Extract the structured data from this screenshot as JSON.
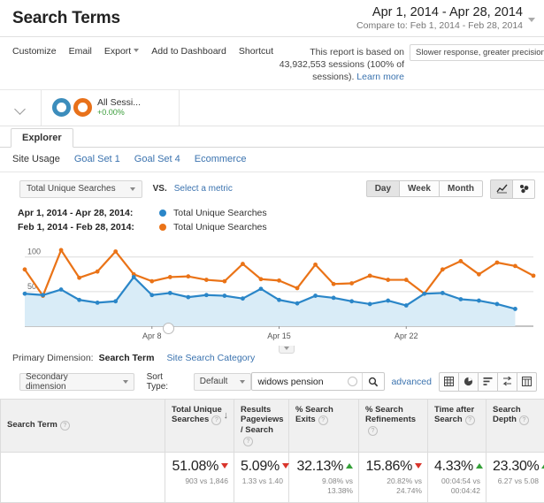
{
  "header": {
    "title": "Search Terms",
    "date_range": "Apr 1, 2014 - Apr 28, 2014",
    "compare_to": "Compare to: Feb 1, 2014 - Feb 28, 2014"
  },
  "actionbar": {
    "actions": [
      {
        "label": "Customize",
        "caret": false
      },
      {
        "label": "Email",
        "caret": false
      },
      {
        "label": "Export",
        "caret": true
      },
      {
        "label": "Add to Dashboard",
        "caret": false
      },
      {
        "label": "Shortcut",
        "caret": false
      }
    ],
    "sampling_line1": "This report is based on",
    "sampling_line2": "43,932,553 sessions (100% of",
    "sampling_line3": "sessions).",
    "sampling_link": "Learn more",
    "precision_option": "Slower response, greater precision"
  },
  "segment": {
    "name": "All Sessi...",
    "change": "+0.00%",
    "color_blue": "#3c8dbc",
    "color_orange": "#e8711a"
  },
  "explorer": {
    "tab": "Explorer",
    "subtabs": [
      {
        "label": "Site Usage",
        "active": true
      },
      {
        "label": "Goal Set 1",
        "active": false
      },
      {
        "label": "Goal Set 4",
        "active": false
      },
      {
        "label": "Ecommerce",
        "active": false
      }
    ]
  },
  "metricrow": {
    "metric": "Total Unique Searches",
    "vs": "VS.",
    "select_metric": "Select a metric",
    "granularity": [
      {
        "label": "Day",
        "active": true
      },
      {
        "label": "Week",
        "active": false
      },
      {
        "label": "Month",
        "active": false
      }
    ]
  },
  "legend": [
    {
      "date": "Apr 1, 2014 - Apr 28, 2014:",
      "color": "#2a86c8",
      "metric": "Total Unique Searches"
    },
    {
      "date": "Feb 1, 2014 - Feb 28, 2014:",
      "color": "#ea7317",
      "metric": "Total Unique Searches"
    }
  ],
  "primary_dimension": {
    "label": "Primary Dimension:",
    "active": "Search Term",
    "link": "Site Search Category"
  },
  "controls": {
    "secondary_dimension": "Secondary dimension",
    "sort_type_label": "Sort Type:",
    "sort_type_value": "Default",
    "search_value": "widows pension",
    "search_placeholder": "",
    "advanced": "advanced"
  },
  "table": {
    "columns": [
      {
        "label": "Search Term",
        "sorted": false
      },
      {
        "label": "Total Unique Searches",
        "sorted": true
      },
      {
        "label": "Results Pageviews / Search",
        "sorted": false
      },
      {
        "label": "% Search Exits",
        "sorted": false
      },
      {
        "label": "% Search Refinements",
        "sorted": false
      },
      {
        "label": "Time after Search",
        "sorted": false
      },
      {
        "label": "Search Depth",
        "sorted": false
      }
    ],
    "summary_row": [
      {
        "value": "51.08%",
        "direction": "down",
        "sub": "903 vs 1,846"
      },
      {
        "value": "5.09%",
        "direction": "down",
        "sub": "1.33 vs 1.40"
      },
      {
        "value": "32.13%",
        "direction": "up",
        "sub": "9.08% vs 13.38%"
      },
      {
        "value": "15.86%",
        "direction": "down",
        "sub": "20.82% vs 24.74%"
      },
      {
        "value": "4.33%",
        "direction": "up",
        "sub": "00:04:54 vs 00:04:42"
      },
      {
        "value": "23.30%",
        "direction": "up",
        "sub": "6.27 vs 5.08"
      }
    ]
  },
  "chart_data": {
    "type": "line",
    "title": "Total Unique Searches",
    "xlabel": "",
    "ylabel": "",
    "ylim": [
      0,
      115
    ],
    "yticks": [
      50,
      100
    ],
    "xticks": [
      "Apr 8",
      "Apr 15",
      "Apr 22"
    ],
    "xtick_indices": [
      7,
      14,
      21
    ],
    "grid": true,
    "legend_position": "above-chart",
    "area_fill": true,
    "x": [
      "Apr 1",
      "Apr 2",
      "Apr 3",
      "Apr 4",
      "Apr 5",
      "Apr 6",
      "Apr 7",
      "Apr 8",
      "Apr 9",
      "Apr 10",
      "Apr 11",
      "Apr 12",
      "Apr 13",
      "Apr 14",
      "Apr 15",
      "Apr 16",
      "Apr 17",
      "Apr 18",
      "Apr 19",
      "Apr 20",
      "Apr 21",
      "Apr 22",
      "Apr 23",
      "Apr 24",
      "Apr 25",
      "Apr 26",
      "Apr 27",
      "Apr 28"
    ],
    "series": [
      {
        "name": "Total Unique Searches",
        "period": "Apr 1, 2014 - Apr 28, 2014",
        "color": "#2a86c8",
        "values": [
          47,
          45,
          53,
          38,
          34,
          36,
          71,
          45,
          48,
          42,
          45,
          44,
          40,
          54,
          38,
          33,
          44,
          41,
          36,
          32,
          37,
          30,
          47,
          48,
          39,
          37,
          32,
          25
        ]
      },
      {
        "name": "Total Unique Searches",
        "period": "Feb 1, 2014 - Feb 28, 2014",
        "color": "#ea7317",
        "values": [
          82,
          44,
          110,
          70,
          79,
          108,
          75,
          65,
          71,
          72,
          67,
          65,
          90,
          68,
          66,
          55,
          89,
          61,
          62,
          73,
          67,
          67,
          47,
          82,
          94,
          75,
          92,
          87,
          73
        ]
      }
    ]
  }
}
